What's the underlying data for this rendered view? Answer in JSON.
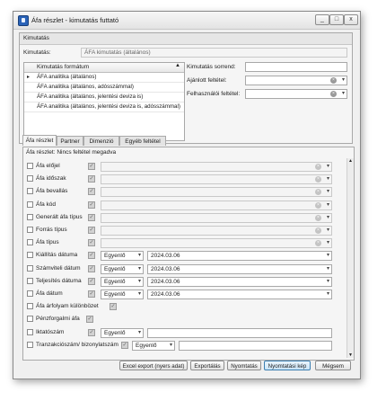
{
  "window": {
    "title": "Áfa részlet - kimutatás futtató",
    "minimize": "_",
    "maximize": "□",
    "close": "x"
  },
  "kimutatas_panel": {
    "header": "Kimutatás",
    "kimutatas_label": "Kimutatás:",
    "kimutatas_value": "ÁFA kimutatás (általános)",
    "grid_header": "Kimutatás formátum",
    "grid_rows": [
      "ÁFA analitika (általános)",
      "ÁFA analitika (általános, adósszámmal)",
      "ÁFA analitika (általános, jelentési deviza is)",
      "ÁFA analitika (általános, jelentési deviza is, adósszámmal)"
    ],
    "sorrend_label": "Kimutatás sorrend:",
    "ajanlott_label": "Ajánlott feltétel:",
    "felhasznaloi_label": "Felhasználói feltétel:"
  },
  "tabs": [
    "Áfa részlet",
    "Partner",
    "Dimenzió",
    "Egyéb feltétel"
  ],
  "filter": {
    "header": "Áfa részlet: Nincs feltétel megadva",
    "rows": [
      {
        "label": "Áfa előjel",
        "kind": "combo"
      },
      {
        "label": "Áfa időszak",
        "kind": "combo"
      },
      {
        "label": "Áfa bevallás",
        "kind": "combo"
      },
      {
        "label": "Áfa kód",
        "kind": "combo"
      },
      {
        "label": "Generált áfa típus",
        "kind": "combo"
      },
      {
        "label": "Forrás típus",
        "kind": "combo"
      },
      {
        "label": "Áfa típus",
        "kind": "combo"
      },
      {
        "label": "Kiállítás dátuma",
        "kind": "date",
        "op": "Egyenlő",
        "value": "2024.03.06"
      },
      {
        "label": "Számviteli dátum",
        "kind": "date",
        "op": "Egyenlő",
        "value": "2024.03.06"
      },
      {
        "label": "Teljesítés dátuma",
        "kind": "date",
        "op": "Egyenlő",
        "value": "2024.03.06"
      },
      {
        "label": "Áfa dátum",
        "kind": "date",
        "op": "Egyenlő",
        "value": "2024.03.06"
      },
      {
        "label": "Áfa árfolyam különbözet",
        "kind": "bool"
      },
      {
        "label": "Pénzforgalmi áfa",
        "kind": "bool"
      },
      {
        "label": "Iktatószám",
        "kind": "text",
        "op": "Egyenlő"
      },
      {
        "label": "Tranzakciószám/ bizonylatszám",
        "kind": "text",
        "op": "Egyenlő"
      }
    ]
  },
  "buttons": {
    "excel": "Excel export (nyers adat)",
    "export": "Exportálás",
    "print": "Nyomtatás",
    "print_image": "Nyomtatási kép",
    "cancel": "Mégsem"
  }
}
